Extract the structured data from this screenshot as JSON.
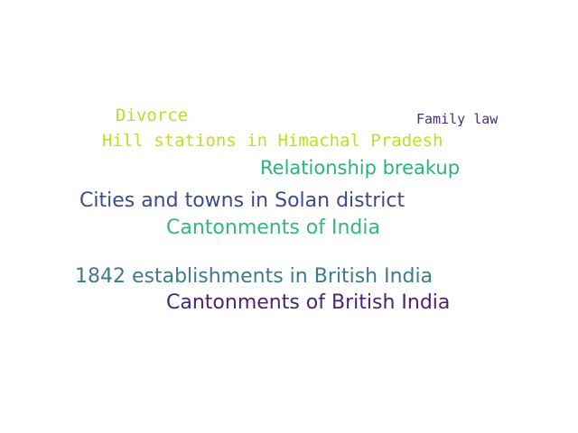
{
  "words": [
    {
      "text": "Divorce",
      "color": "#b5de2b",
      "weight": 2
    },
    {
      "text": "Family law",
      "color": "#472f7d",
      "weight": 1
    },
    {
      "text": "Hill stations in Himachal Pradesh",
      "color": "#bddf26",
      "weight": 2
    },
    {
      "text": "Relationship breakup",
      "color": "#2db27d",
      "weight": 3
    },
    {
      "text": "Cities and towns in Solan district",
      "color": "#3e4a89",
      "weight": 4
    },
    {
      "text": "Cantonments of India",
      "color": "#35b779",
      "weight": 4
    },
    {
      "text": "1842 establishments in British India",
      "color": "#3b7c8c",
      "weight": 4
    },
    {
      "text": "Cantonments of British India",
      "color": "#482475",
      "weight": 4
    }
  ]
}
